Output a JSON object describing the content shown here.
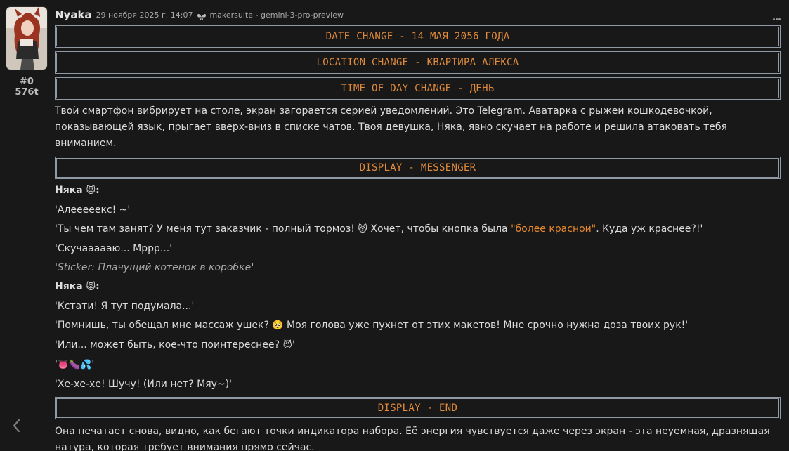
{
  "message": {
    "char_name": "Nyaka",
    "timestamp": "29 ноября 2025 г. 14:07",
    "model": "makersuite - gemini-3-pro-preview",
    "mes_id": "#0",
    "tokens": "576t",
    "icons": {
      "model_icon": "model-provider-icon",
      "menu": "more-options-icon",
      "swipe_left": "chevron-left-icon"
    }
  },
  "banners": {
    "date": "DATE CHANGE - 14 МАЯ 2056 ГОДА",
    "location": "LOCATION CHANGE - КВАРТИРА АЛЕКСА",
    "time": "TIME OF DAY CHANGE - ДЕНЬ",
    "display": "DISPLAY - MESSENGER",
    "display_end": "DISPLAY - END"
  },
  "narration_1": "Твой смартфон вибрирует на столе, экран загорается серией уведомлений. Это Telegram. Аватарка с рыжей кошкодевочкой, показывающей язык, прыгает вверх-вниз в списке чатов. Твоя девушка, Няка, явно скучает на работе и решила атаковать тебя вниманием.",
  "chat": {
    "speaker": "Няка",
    "speaker_emoji": "😾",
    "speaker_suffix": ":",
    "m1": "'Алееееекс! ~'",
    "m2_pre": "'Ты чем там занят? У меня тут заказчик - полный тормоз! ",
    "m2_emoji": "😾",
    "m2_mid": " Хочет, чтобы кнопка была ",
    "m2_hl": "\"более красной\"",
    "m2_post": ". Куда уж краснее?!'",
    "m3": "'Скучаааааю... Мррр...'",
    "m4_quote_open": "'",
    "m4_sticker": "Sticker: Плачущий котенок в коробке",
    "m4_quote_close": "'",
    "m5": "'Кстати! Я тут подумала...'",
    "m6_pre": "'Помнишь, ты обещал мне массаж ушек? ",
    "m6_emoji": "🥺",
    "m6_post": " Моя голова уже пухнет от этих макетов! Мне срочно нужна доза твоих рук!'",
    "m7_pre": "'Или... может быть, кое-что поинтереснее? ",
    "m7_emoji": "😈",
    "m7_post": "'",
    "m8_open": "'",
    "m8_emojis": "👅🍆💦",
    "m8_close": "'",
    "m9": "'Хе-хе-хе! Шучу! (Или нет? Мяу~)'"
  },
  "narration_2": "Она печатает снова, видно, как бегают точки индикатора набора. Её энергия чувствуется даже через экран - эта неуемная, дразнящая натура, которая требует внимания прямо сейчас."
}
